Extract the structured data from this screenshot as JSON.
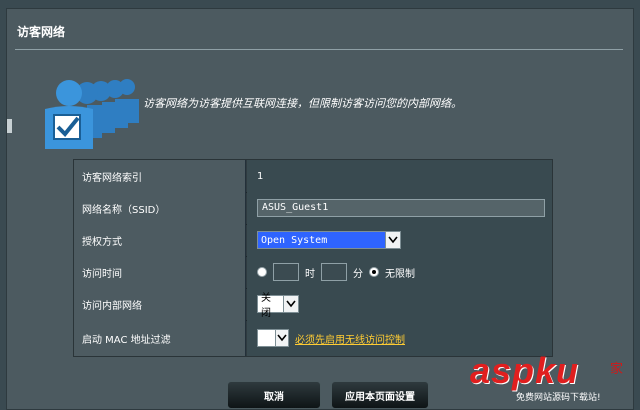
{
  "page": {
    "title": "访客网络"
  },
  "description": "访客网络为访客提供互联网连接，但限制访客访问您的内部网络。",
  "form": {
    "rows": [
      {
        "label": "访客网络索引",
        "value": "1"
      },
      {
        "label": "网络名称（SSID）",
        "ssid": "ASUS_Guest1"
      },
      {
        "label": "授权方式",
        "selected": "Open System"
      },
      {
        "label": "访问时间",
        "hour_unit": "时",
        "minute_unit": "分",
        "unlimited": "无限制",
        "selected_option": "unlimited"
      },
      {
        "label": "访问内部网络",
        "selected": "关闭"
      },
      {
        "label": "启动 MAC 地址过滤",
        "selected": "",
        "warning_link": "必须先启用无线访问控制"
      }
    ]
  },
  "buttons": {
    "cancel": "取消",
    "apply": "应用本页面设置"
  },
  "watermark": {
    "brand": "aspku",
    "suffix": "com",
    "cn": "家",
    "tagline": "免费网站源码下载站!"
  },
  "colors": {
    "background": "#3a4a51",
    "panel": "#4c5a60",
    "accent": "#2f64ff",
    "warning": "#ffcc33",
    "icon": "#3b8fd1"
  },
  "icons": [
    "guest-users-icon",
    "checkbox-icon",
    "chevron-down-icon"
  ]
}
